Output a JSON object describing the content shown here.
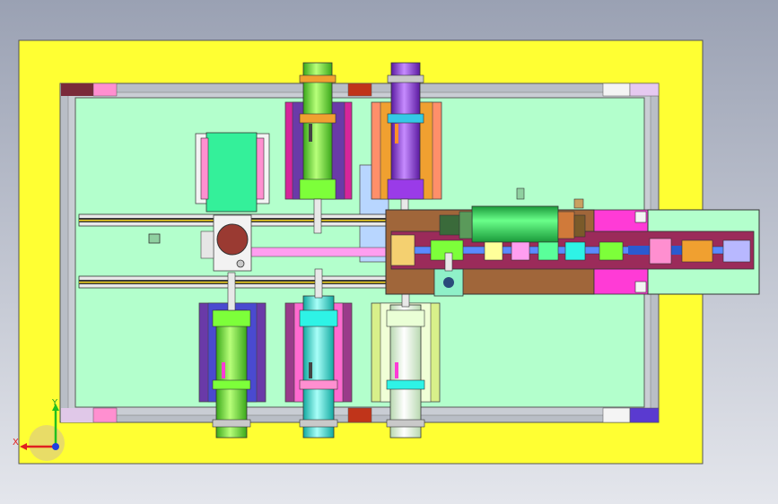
{
  "viewport": {
    "background_top": "#9aa1b3",
    "background_bottom": "#e4e6ec"
  },
  "colors": {
    "frame_yellow": "#ffff33",
    "frame_grey": "#b9bec6",
    "plate_green": "#b3ffcc",
    "rail_dark": "#3a3a3a",
    "rail_yellow": "#f2d21c",
    "cyl_green": "#7dff3a",
    "cyl_purple": "#9a3be8",
    "cyl_cyan": "#2ef3e6",
    "cyl_ivory": "#eaffd6",
    "mount_magenta": "#d6259a",
    "mount_purple": "#6a3aa8",
    "carriage_brown": "#a0663a",
    "carriage_maroon": "#9b2b5a",
    "slot_magenta": "#ff3bd6",
    "motor_green": "#22dd55",
    "collar_orange": "#f0a030",
    "pink_corner": "#ff8fd0"
  },
  "triad": {
    "x_label": "X",
    "y_label": "Y",
    "x_color": "#e02020",
    "y_color": "#20c020",
    "z_color": "#2040e0"
  }
}
